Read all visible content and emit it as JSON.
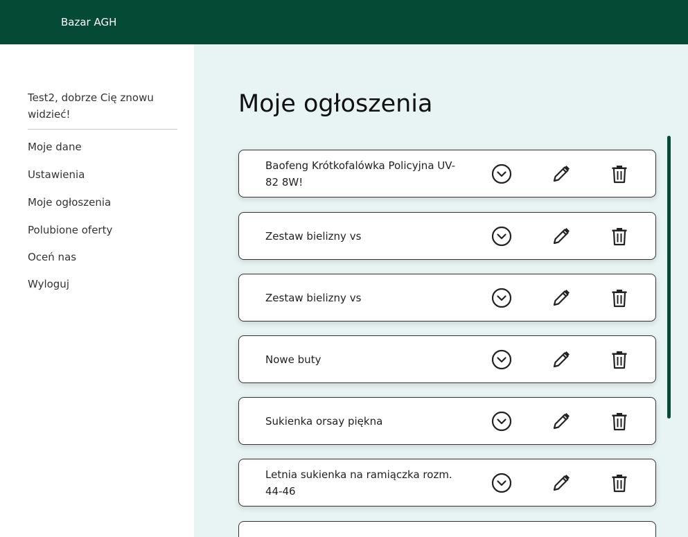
{
  "header": {
    "brand": "Bazar AGH"
  },
  "sidebar": {
    "greeting": "Test2, dobrze Cię znowu widzieć!",
    "items": [
      {
        "label": "Moje dane"
      },
      {
        "label": "Ustawienia"
      },
      {
        "label": "Moje ogłoszenia"
      },
      {
        "label": "Polubione oferty"
      },
      {
        "label": "Oceń nas"
      },
      {
        "label": "Wyloguj"
      }
    ]
  },
  "main": {
    "title": "Moje ogłoszenia",
    "listings": [
      {
        "title": "Baofeng Krótkofalówka Policyjna UV-82 8W!"
      },
      {
        "title": "Zestaw bielizny vs"
      },
      {
        "title": "Zestaw bielizny vs"
      },
      {
        "title": "Nowe buty"
      },
      {
        "title": "Sukienka orsay piękna"
      },
      {
        "title": "Letnia sukienka na ramiączka rozm. 44-46"
      },
      {
        "title": ""
      }
    ]
  },
  "icons": {
    "expand": "chevron-down-circle-icon",
    "edit": "pencil-icon",
    "delete": "trash-icon"
  },
  "colors": {
    "header_bg": "#054a35",
    "content_bg": "#e8f3f4",
    "accent": "#054a35"
  }
}
